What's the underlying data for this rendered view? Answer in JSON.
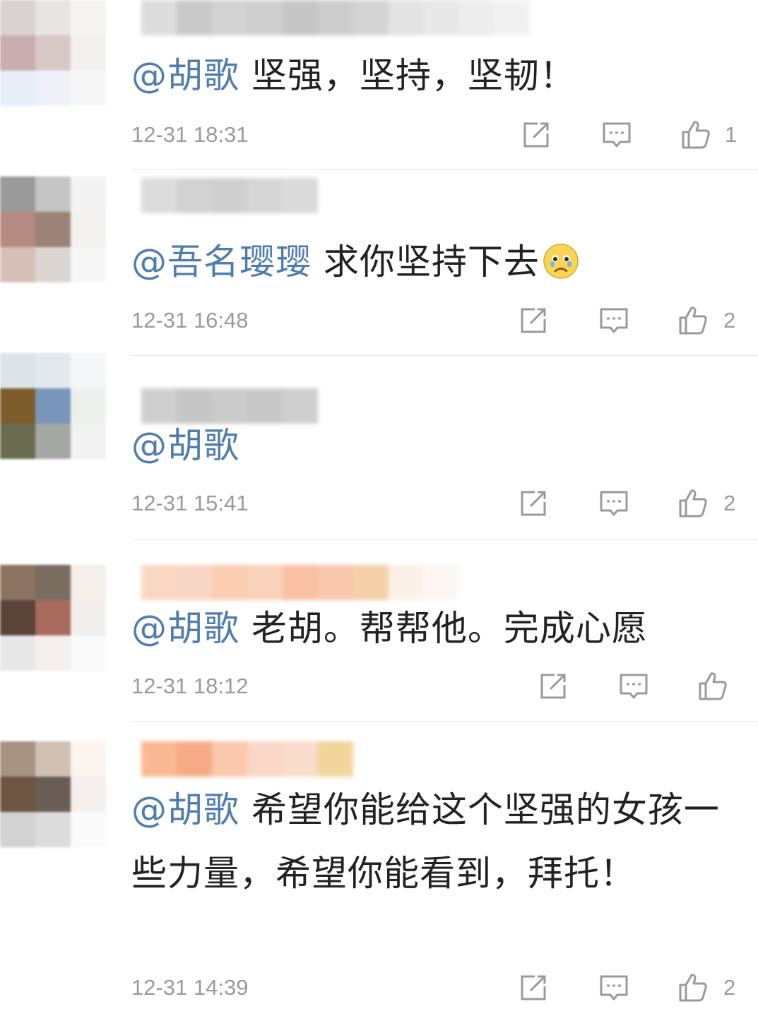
{
  "comments": [
    {
      "mention": "@胡歌",
      "text": " 坚强，坚持，坚韧！",
      "time": "12-31 18:31",
      "likes": "1",
      "avatar_colors": [
        "#d8d2d0",
        "#e8e4e2",
        "#f6f4f2",
        "#c8aeb0",
        "#d8c8c6",
        "#f3f1f0",
        "#e7eef8",
        "#eef2f8",
        "#f7f7f8"
      ],
      "name_colors": [
        "#dcdcdc",
        "#c9c9c9",
        "#d2d2d2",
        "#cfcfcf",
        "#c6c6c6",
        "#cdcdcd",
        "#d4d4d4",
        "#e3e3e3",
        "#e8e8e8",
        "#ededed",
        "#f1f1f1"
      ]
    },
    {
      "mention": "@吾名璎璎",
      "text": " 求你坚持下去",
      "emoji": "crying-face-emoji",
      "time": "12-31 16:48",
      "likes": "2",
      "avatar_colors": [
        "#9a9a9a",
        "#c5c5c5",
        "#f3f3f3",
        "#b58a80",
        "#9b8378",
        "#f4f2f1",
        "#d6c1b9",
        "#dcd6d3",
        "#f7f7f7"
      ],
      "name_colors": [
        "#dcdcdc",
        "#d2d2d2",
        "#cfcfcf",
        "#d6d6d6",
        "#dadada"
      ]
    },
    {
      "mention": "@胡歌",
      "text": "",
      "time": "12-31 15:41",
      "likes": "2",
      "avatar_colors": [
        "#dde3e8",
        "#e3e8ee",
        "#f6f7f8",
        "#7d5d2a",
        "#7895ba",
        "#eef0ee",
        "#6a6a4f",
        "#a3a8a2",
        "#f1f2f1"
      ],
      "name_colors": [
        "#cfcfcf",
        "#c6c6c6",
        "#cbcbcb",
        "#c8c8c8",
        "#cecece"
      ]
    },
    {
      "mention": "@胡歌",
      "text": " 老胡。帮帮他。完成心愿",
      "time": "12-31 18:12",
      "likes": "",
      "avatar_colors": [
        "#8b7362",
        "#7b6c60",
        "#f5efea",
        "#5a4438",
        "#a86b5d",
        "#f2eeec",
        "#e8e8e8",
        "#f4eeee",
        "#fafafa"
      ],
      "name_colors": [
        "#fad7c2",
        "#f8d6c5",
        "#fbcdb1",
        "#f8d2bb",
        "#f9c0a3",
        "#f8c7ac",
        "#f5d0a8",
        "#fbf1ea",
        "#fdf7f3"
      ]
    },
    {
      "mention": "@胡歌",
      "text": " 希望你能给这个坚强的女孩一些力量，希望你能看到，拜托！",
      "time": "12-31 14:39",
      "likes": "2",
      "avatar_colors": [
        "#a79382",
        "#cfc0b2",
        "#fbf4ef",
        "#6e5443",
        "#6a5d55",
        "#f4efec",
        "#d2d2d2",
        "#dcdcdc",
        "#fafafa"
      ],
      "name_colors": [
        "#f9b893",
        "#f6ab85",
        "#f9c8ad",
        "#fad6c6",
        "#f9dcc9",
        "#f3d49a"
      ]
    }
  ],
  "colors": {
    "mention": "#4f7eae",
    "meta": "#9a9a9a",
    "divider": "#e6e6e6"
  },
  "icons": {
    "share": "share-icon",
    "reply": "comment-icon",
    "like": "thumbs-up-icon"
  }
}
